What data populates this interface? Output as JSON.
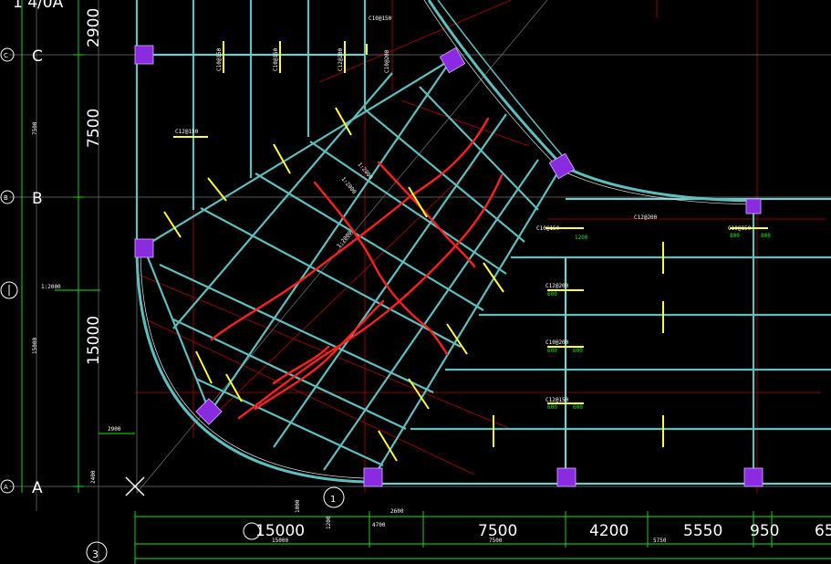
{
  "drawing": {
    "title_fragment": "1 4/0A",
    "grid_bubbles_left": [
      "C",
      "B",
      "A"
    ],
    "grid_bubbles_bottom": [
      "1",
      "3"
    ],
    "row_letters": [
      "C",
      "B",
      "A"
    ],
    "left_dimensions": [
      "2900",
      "7500",
      "15000"
    ],
    "bottom_dimensions": [
      "15000",
      "7500",
      "4200",
      "5550",
      "950",
      "65"
    ],
    "left_dim_small": [
      "7500",
      "15000"
    ],
    "detail_labels": [
      "1:2000",
      "1:2000",
      "1:2000",
      "1:2000"
    ],
    "small_dims": [
      "2900",
      "2600",
      "4700",
      "7500",
      "5750",
      "15000",
      "2400",
      "1000",
      "1200",
      "4000"
    ],
    "rebar_labels": [
      "C10@150",
      "C10@150",
      "C12@200",
      "C10@200",
      "C10@150",
      "C12@150",
      "C10@150",
      "C12@200",
      "C10@150",
      "C12@200",
      "C10@200",
      "C12@150"
    ],
    "green_labels": [
      "600",
      "1200",
      "800",
      "600",
      "600",
      "600",
      "600",
      "800"
    ],
    "colors": {
      "background": "#000000",
      "beam": "#5fbfbf",
      "beam_inner": "#c8e6e6",
      "column": "#8a2be2",
      "rebar_note": "#ffff33",
      "crack_marks": "#ff2020",
      "axis_red": "#b00000",
      "axis_gray": "#888888",
      "dim_green": "#19e619"
    }
  }
}
